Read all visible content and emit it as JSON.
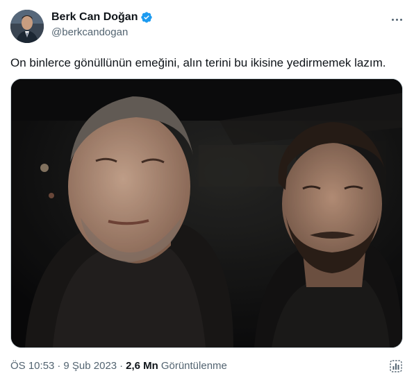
{
  "author": {
    "display_name": "Berk Can Doğan",
    "handle": "@berkcandogan",
    "verified": true,
    "verified_color": "#1d9bf0"
  },
  "tweet": {
    "text": "On binlerce gönüllünün emeğini, alın terini bu ikisine yedirmemek lazım.",
    "time": "ÖS 10:53",
    "date": "9 Şub 2023",
    "separator": "·",
    "views_count": "2,6 Mn",
    "views_label": "Görüntülenme"
  },
  "media": {
    "type": "photo",
    "content": "selfie of two men at night"
  },
  "icons": {
    "more": "more-horizontal-icon",
    "verified": "verified-badge-icon",
    "analytics": "analytics-icon"
  },
  "colors": {
    "text_primary": "#0f1419",
    "text_secondary": "#536471",
    "border": "#cfd9de",
    "accent": "#1d9bf0"
  }
}
